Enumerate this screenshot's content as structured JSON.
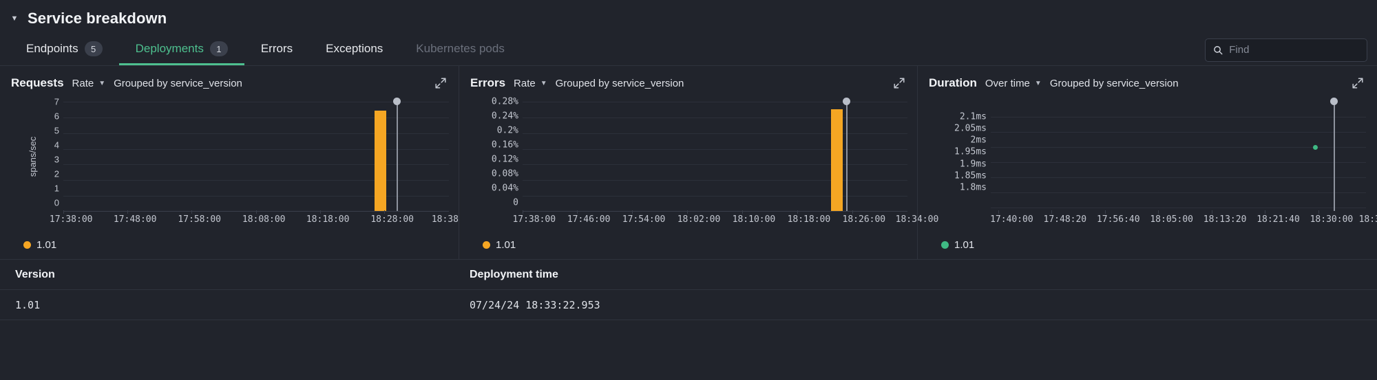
{
  "header": {
    "title": "Service breakdown",
    "caret_icon": "caret-down-icon"
  },
  "tabs": [
    {
      "label": "Endpoints",
      "badge": "5",
      "state": "normal"
    },
    {
      "label": "Deployments",
      "badge": "1",
      "state": "active"
    },
    {
      "label": "Errors",
      "badge": "",
      "state": "normal"
    },
    {
      "label": "Exceptions",
      "badge": "",
      "state": "normal"
    },
    {
      "label": "Kubernetes pods",
      "badge": "",
      "state": "disabled"
    }
  ],
  "search": {
    "placeholder": "Find",
    "value": "",
    "icon": "search-icon"
  },
  "colors": {
    "accent_green": "#4ec08f",
    "series_orange": "#f5a623",
    "series_green": "#3fb984",
    "marker_grey": "#b9bec8",
    "background": "#21242c",
    "border": "#2f333d"
  },
  "panels": [
    {
      "title": "Requests",
      "mode": "Rate",
      "group_by": "Grouped by service_version",
      "expand_icon": "expand-icon",
      "legend": {
        "label": "1.01",
        "color": "#f5a623"
      }
    },
    {
      "title": "Errors",
      "mode": "Rate",
      "group_by": "Grouped by service_version",
      "expand_icon": "expand-icon",
      "legend": {
        "label": "1.01",
        "color": "#f5a623"
      }
    },
    {
      "title": "Duration",
      "mode": "Over time",
      "group_by": "Grouped by service_version",
      "expand_icon": "expand-icon",
      "legend": {
        "label": "1.01",
        "color": "#3fb984"
      }
    }
  ],
  "chart_data": [
    {
      "type": "bar",
      "title": "Requests",
      "ylabel": "spans/sec",
      "xlabel": "",
      "yticks": [
        "7",
        "6",
        "5",
        "4",
        "3",
        "2",
        "1",
        "0"
      ],
      "ylim": [
        0,
        7
      ],
      "xticks": [
        "17:38:00",
        "17:48:00",
        "17:58:00",
        "18:08:00",
        "18:18:00",
        "18:28:00",
        "18:38"
      ],
      "series": [
        {
          "name": "1.01",
          "color": "#f5a623",
          "points": [
            {
              "x": "18:28:00",
              "y": 6.4
            }
          ]
        }
      ],
      "annotations": [
        {
          "type": "deployment-marker",
          "x": "18:31:00",
          "label": "1.01",
          "color": "#b9bec8"
        }
      ],
      "grid": true,
      "legend_position": "bottom-left"
    },
    {
      "type": "bar",
      "title": "Errors",
      "ylabel": "",
      "xlabel": "",
      "yticks": [
        "0.28%",
        "0.24%",
        "0.2%",
        "0.16%",
        "0.12%",
        "0.08%",
        "0.04%",
        "0"
      ],
      "ylim": [
        0,
        0.28
      ],
      "xticks": [
        "17:38:00",
        "17:46:00",
        "17:54:00",
        "18:02:00",
        "18:10:00",
        "18:18:00",
        "18:26:00",
        "18:34:00"
      ],
      "series": [
        {
          "name": "1.01",
          "color": "#f5a623",
          "points": [
            {
              "x": "18:28:00",
              "y": 0.265
            }
          ]
        }
      ],
      "annotations": [
        {
          "type": "deployment-marker",
          "x": "18:33:00",
          "label": "1.01",
          "color": "#b9bec8"
        }
      ],
      "grid": true,
      "legend_position": "bottom-left"
    },
    {
      "type": "scatter",
      "title": "Duration",
      "ylabel": "",
      "xlabel": "",
      "yticks": [
        "2.1ms",
        "2.05ms",
        "2ms",
        "1.95ms",
        "1.9ms",
        "1.85ms",
        "1.8ms"
      ],
      "ylim": [
        1.8,
        2.1
      ],
      "xticks": [
        "17:40:00",
        "17:48:20",
        "17:56:40",
        "18:05:00",
        "18:13:20",
        "18:21:40",
        "18:30:00",
        "18:3"
      ],
      "series": [
        {
          "name": "1.01",
          "color": "#3fb984",
          "points": [
            {
              "x": "18:28:20",
              "y": 1.95
            }
          ]
        }
      ],
      "annotations": [
        {
          "type": "deployment-marker",
          "x": "18:33:00",
          "label": "1.01",
          "color": "#b9bec8"
        }
      ],
      "grid": true,
      "legend_position": "bottom-left"
    }
  ],
  "table": {
    "columns": [
      "Version",
      "Deployment time"
    ],
    "rows": [
      {
        "version": "1.01",
        "deployment_time": "07/24/24 18:33:22.953"
      }
    ]
  }
}
